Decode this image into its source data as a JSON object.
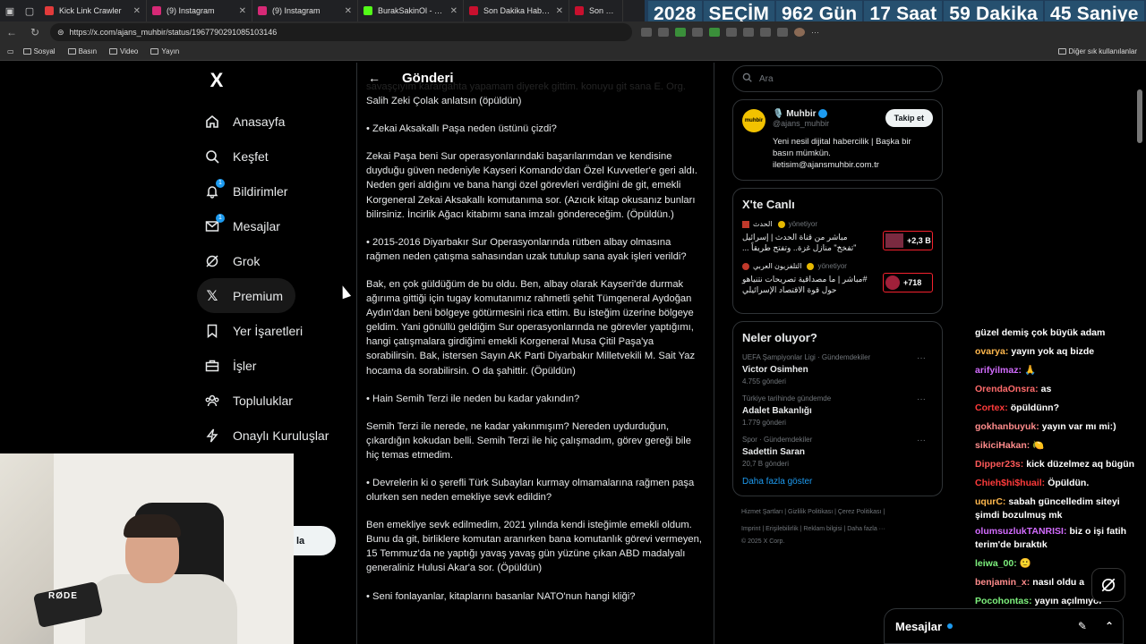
{
  "browser": {
    "tabs": [
      {
        "title": "Kick Link Crawler",
        "color": "#e23b3b"
      },
      {
        "title": "(9) Instagram",
        "color": "#d62976"
      },
      {
        "title": "(9) Instagram",
        "color": "#d62976"
      },
      {
        "title": "BurakSakinOl - Watch",
        "color": "#53fc18"
      },
      {
        "title": "Son Dakika Haberleri,",
        "color": "#c8102e"
      },
      {
        "title": "Son dakika",
        "color": "#c8102e"
      }
    ],
    "url": "https://x.com/ajans_muhbir/status/1967790291085103146",
    "bookmarks": [
      "Sosyal",
      "Basın",
      "Video",
      "Yayın"
    ],
    "other_bookmarks": "Diğer sık kullanılanlar"
  },
  "countdown": {
    "year": "2028",
    "label": "SEÇİM",
    "days": "962 Gün",
    "hours": "17 Saat",
    "minutes": "59 Dakika",
    "seconds": "45 Saniye"
  },
  "nav": {
    "logo": "X",
    "items": [
      {
        "label": "Anasayfa",
        "icon": "home-icon"
      },
      {
        "label": "Keşfet",
        "icon": "search-icon"
      },
      {
        "label": "Bildirimler",
        "icon": "bell-icon",
        "badge": "1"
      },
      {
        "label": "Mesajlar",
        "icon": "mail-icon",
        "badge": "1"
      },
      {
        "label": "Grok",
        "icon": "grok-icon"
      },
      {
        "label": "Premium",
        "icon": "x-icon"
      },
      {
        "label": "Yer İşaretleri",
        "icon": "bookmark-icon"
      },
      {
        "label": "İşler",
        "icon": "briefcase-icon"
      },
      {
        "label": "Topluluklar",
        "icon": "people-icon"
      },
      {
        "label": "Onaylı Kuruluşlar",
        "icon": "lightning-icon"
      }
    ],
    "post_button_fragment": "la"
  },
  "main": {
    "header_title": "Gönderi",
    "paragraphs": [
      "savaşçıyım karargahta yapamam diyerek gittim. konuyu git sana E. Org. Salih Zeki Çolak anlatsın (öpüldün)",
      "• Zekai Aksakallı Paşa neden üstünü çizdi?",
      "Zekai Paşa beni Sur operasyonlarındaki başarılarımdan ve kendisine duyduğu güven nedeniyle Kayseri Komando'dan Özel Kuvvetler'e geri aldı. Neden geri aldığını ve bana hangi özel görevleri verdiğini de git, emekli Korgeneral Zekai Aksakallı komutanıma sor. (Azıcık kitap okusanız bunları bilirsiniz. İncirlik Ağacı kitabımı sana imzalı göndereceğim. (Öpüldün.)",
      "• 2015-2016 Diyarbakır Sur Operasyonlarında rütben albay olmasına rağmen neden çatışma sahasından uzak tutulup sana ayak işleri verildi?",
      "Bak, en çok güldüğüm de bu oldu. Ben, albay olarak Kayseri'de durmak ağırıma gittiği için tugay komutanımız rahmetli şehit Tümgeneral Aydoğan Aydın'dan beni bölgeye götürmesini rica ettim. Bu isteğim üzerine bölgeye geldim. Yani gönüllü geldiğim Sur operasyonlarında ne görevler yaptığımı, hangi çatışmalara girdiğimi emekli Korgeneral Musa Çitil Paşa'ya sorabilirsin. Bak, istersen Sayın AK Parti Diyarbakır Milletvekili M. Sait Yaz hocama da sorabilirsin. O da şahittir. (Öpüldün)",
      "• Hain Semih Terzi ile neden bu kadar yakındın?",
      "Semih Terzi ile nerede, ne kadar yakınmışım? Nereden uydurduğun, çıkardığın kokudan belli. Semih Terzi ile hiç çalışmadım, görev gereği bile hiç temas etmedim.",
      "• Devrelerin ki o şerefli Türk Subayları kurmay olmamalarına rağmen paşa olurken sen neden emekliye sevk edildin?",
      "Ben emekliye sevk edilmedim, 2021 yılında kendi isteğimle emekli oldum. Bunu da git, birliklere komutan aranırken bana komutanlık görevi vermeyen, 15 Temmuz'da ne yaptığı yavaş yavaş gün yüzüne çıkan ABD madalyalı generaliniz Hulusi Akar'a sor. (Öpüldün)",
      "• Seni fonlayanlar, kitaplarını basanlar NATO'nun hangi kliği?"
    ]
  },
  "right": {
    "search_placeholder": "Ara",
    "profile": {
      "name": "🎙️ Muhbir",
      "handle": "@ajans_muhbir",
      "avatar_text": "muhbir",
      "follow": "Takip et",
      "bio": "Yeni nesil dijital habercilik | Başka bir basın mümkün. iletisim@ajansmuhbir.com.tr"
    },
    "live": {
      "title": "X'te Canlı",
      "items": [
        {
          "source": "الحدث",
          "status": "yönetiyor",
          "text": "مباشر من قناة الحدث | إسرائيل \"تفخخ\" منازل غزة.. وتفتح طريقاً ...",
          "count": "+2,3 B"
        },
        {
          "source": "التلفزيون العربي",
          "status": "yönetiyor",
          "text": "#مباشر | ما مصداقية تصريحات نتنياهو حول قوة الاقتصاد الإسرائيلي",
          "count": "+718"
        }
      ]
    },
    "trends": {
      "title": "Neler oluyor?",
      "items": [
        {
          "category": "UEFA Şampiyonlar Ligi · Gündemdekiler",
          "name": "Victor Osimhen",
          "count": "4.755 gönderi"
        },
        {
          "category": "Türkiye tarihinde gündemde",
          "name": "Adalet Bakanlığı",
          "count": "1.779 gönderi"
        },
        {
          "category": "Spor · Gündemdekiler",
          "name": "Sadettin Saran",
          "count": "20,7 B gönderi"
        }
      ],
      "show_more": "Daha fazla göster"
    },
    "footer": {
      "line1": "Hizmet Şartları   |   Gizlilik Politikası   |   Çerez Politikası   |",
      "line2": "Imprint   |   Erişilebilirlik   |   Reklam bilgisi   |   Daha fazla ···",
      "line3": "© 2025 X Corp."
    }
  },
  "chat": [
    {
      "user": "",
      "msg": "güzel demiş çok büyük adam",
      "color": "#ffffff"
    },
    {
      "user": "ovarya:",
      "msg": "yayın yok aq bizde",
      "color": "#ffb84d"
    },
    {
      "user": "arifyilmaz:",
      "msg": "🙏",
      "color": "#d36cff"
    },
    {
      "user": "OrendaOnsra:",
      "msg": "as",
      "color": "#ff6b6b"
    },
    {
      "user": "Cortex:",
      "msg": "öpüldünn?",
      "color": "#ff3b3b"
    },
    {
      "user": "gokhanbuyuk:",
      "msg": "yayın var mı mi:)",
      "color": "#ff8c8c"
    },
    {
      "user": "sikiciHakan:",
      "msg": "🍋",
      "color": "#ff8c8c"
    },
    {
      "user": "Dipper23s:",
      "msg": "kick düzelmez aq bügün",
      "color": "#ff5a5a",
      "wrap": true
    },
    {
      "user": "Chieh$hi$huail:",
      "msg": "Öpüldün.",
      "color": "#ff3b3b"
    },
    {
      "user": "uqurC:",
      "msg": "sabah güncelledim siteyi şimdi bozulmuş mk",
      "color": "#ffb84d",
      "wrap": true
    },
    {
      "user": "olumsuzlukTANRISI:",
      "msg": "biz o işi fatih terim'de bıraktık",
      "color": "#d36cff",
      "wrap": true
    },
    {
      "user": "leiwa_00:",
      "msg": "🙂",
      "color": "#7df07d"
    },
    {
      "user": "benjamin_x:",
      "msg": "nasıl oldu a",
      "color": "#ff8c8c"
    },
    {
      "user": "Pocohontas:",
      "msg": "yayın açılmıyor yapacagin isi kick",
      "color": "#7df07d",
      "wrap": true
    }
  ],
  "dock": {
    "messages": "Mesajlar"
  },
  "webcam": {
    "mic_label": "RØDE"
  }
}
